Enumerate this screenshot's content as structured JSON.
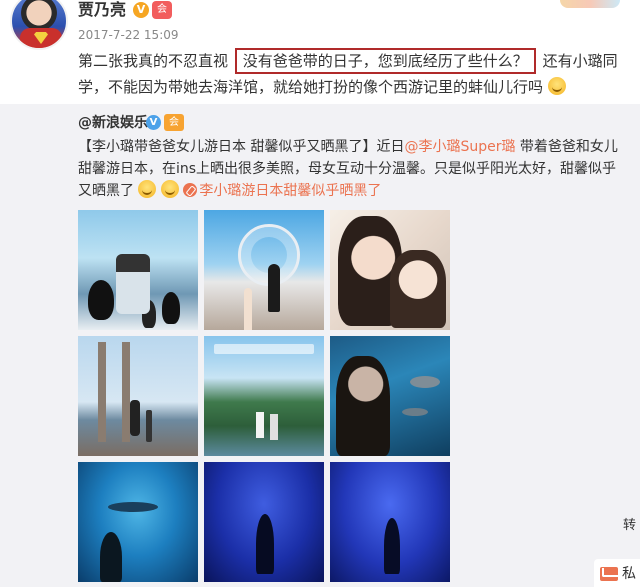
{
  "post": {
    "author": "贾乃亮",
    "v_badge": "V",
    "member_badge": "会",
    "timestamp": "2017-7-22 15:09",
    "text_before": "第二张我真的不忍直视",
    "highlighted": "没有爸爸带的日子，您到底经历了些什么？",
    "text_after": "还有小璐同学，不能因为带她去海洋馆，就给她打扮的像个西游记里的蚌仙儿行吗"
  },
  "repost": {
    "author": "@新浪娱乐",
    "v_badge": "V",
    "member_badge": "会",
    "topic": "【李小璐带爸爸女儿游日本 甜馨似乎又晒黑了】",
    "text_1": "近日",
    "mention": "@李小璐Super璐",
    "text_2": "带着爸爸和女儿甜馨游日本，在ins上晒出很多美照，母女互动十分温馨。只是似乎阳光太好，甜馨似乎又晒黑了",
    "link_text": "李小璐游日本甜馨似乎晒黑了",
    "photos": [
      "photo-1",
      "photo-2",
      "photo-3",
      "photo-4",
      "photo-5",
      "photo-6",
      "photo-7",
      "photo-8",
      "photo-9"
    ]
  },
  "ui": {
    "side_label": "转",
    "float_label": "私"
  },
  "colors": {
    "link": "#eb7350",
    "highlight_border": "#b02a2a",
    "repost_bg": "#f2f2f5"
  }
}
